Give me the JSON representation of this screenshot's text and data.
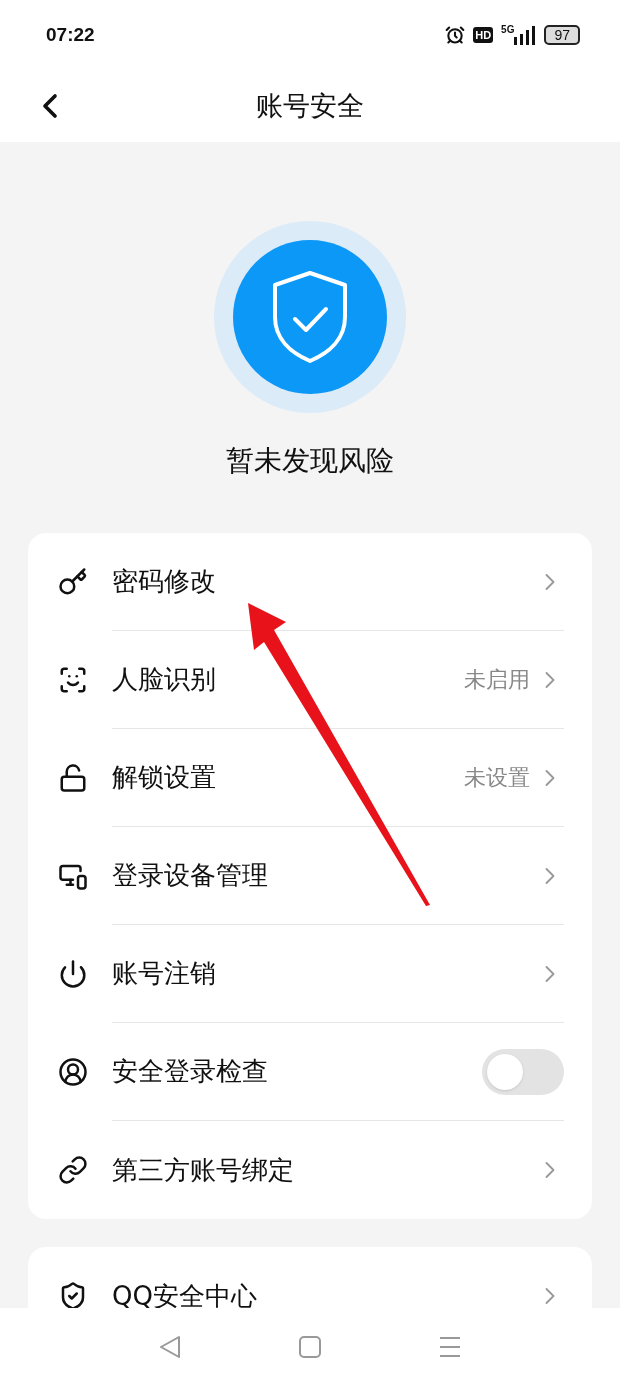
{
  "status_bar": {
    "time": "07:22",
    "hd": "HD",
    "network": "5G",
    "battery": "97"
  },
  "header": {
    "title": "账号安全"
  },
  "hero": {
    "message": "暂未发现风险"
  },
  "settings": [
    {
      "kind": "link",
      "label": "密码修改"
    },
    {
      "kind": "link",
      "label": "人脸识别",
      "value": "未启用"
    },
    {
      "kind": "link",
      "label": "解锁设置",
      "value": "未设置"
    },
    {
      "kind": "link",
      "label": "登录设备管理"
    },
    {
      "kind": "link",
      "label": "账号注销"
    },
    {
      "kind": "toggle",
      "label": "安全登录检查",
      "on": false
    },
    {
      "kind": "link",
      "label": "第三方账号绑定"
    }
  ],
  "more_settings": [
    {
      "kind": "link",
      "label": "QQ安全中心"
    }
  ]
}
